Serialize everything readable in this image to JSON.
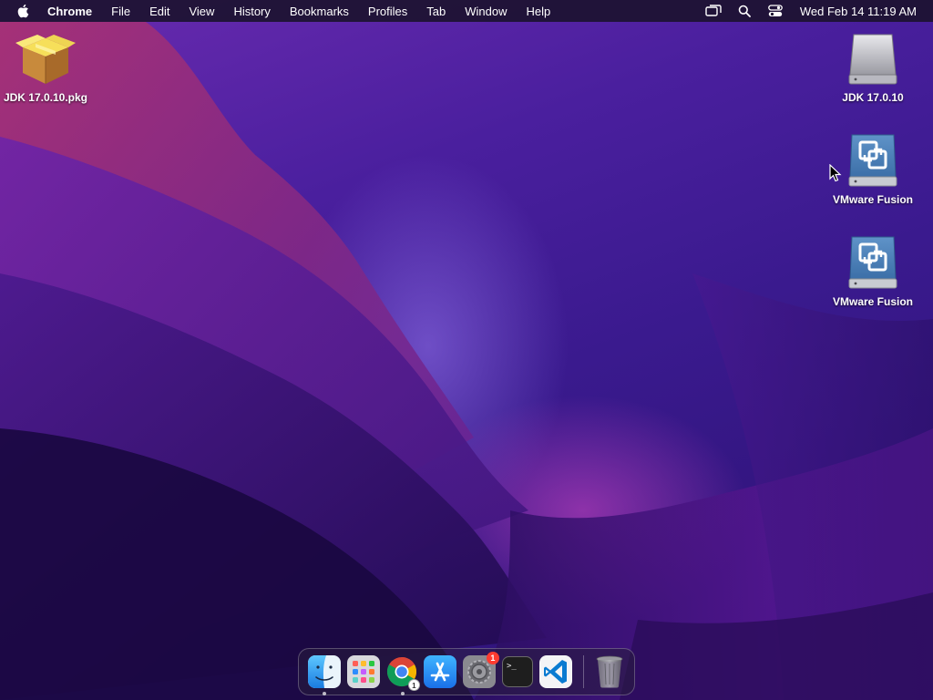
{
  "menubar": {
    "app_name": "Chrome",
    "menus": [
      "File",
      "Edit",
      "View",
      "History",
      "Bookmarks",
      "Profiles",
      "Tab",
      "Window",
      "Help"
    ],
    "clock": "Wed Feb 14  11:19 AM"
  },
  "desktop": {
    "icons": [
      {
        "label": "JDK 17.0.10.pkg",
        "icon": "package-icon"
      },
      {
        "label": "JDK 17.0.10",
        "icon": "disk-drive-icon"
      },
      {
        "label": "VMware Fusion",
        "icon": "vmware-disk-icon"
      },
      {
        "label": "VMware Fusion",
        "icon": "vmware-disk-icon"
      }
    ]
  },
  "dock": {
    "chrome_badge": "1",
    "settings_badge": "1",
    "terminal_prompt": ">_"
  },
  "colors": {
    "menubar_bg": "#1c1230",
    "accent": "#7a2fd0",
    "badge_red": "#ff3b30"
  }
}
